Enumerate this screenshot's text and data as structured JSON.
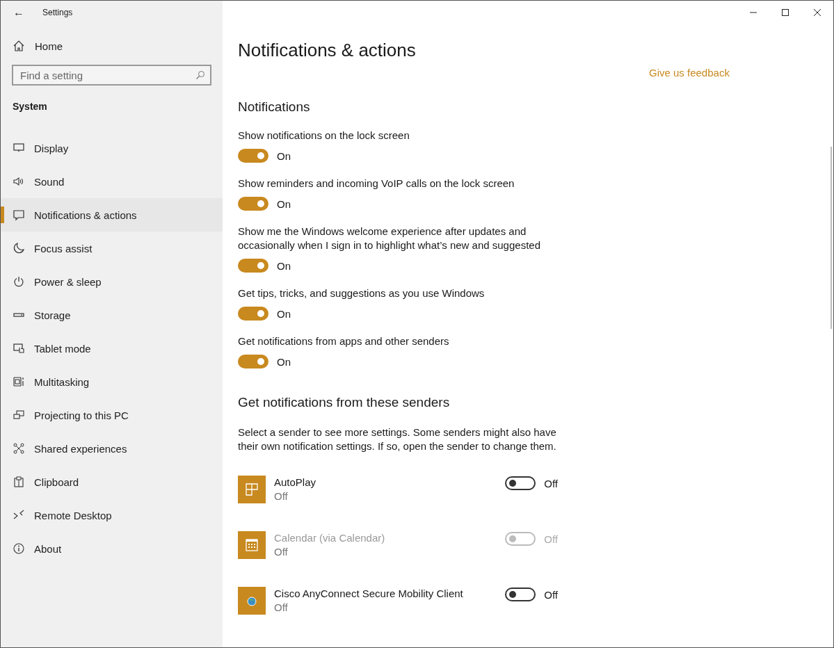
{
  "window": {
    "title": "Settings",
    "back": "←"
  },
  "sidebar": {
    "home": "Home",
    "search": {
      "placeholder": "Find a setting"
    },
    "section": "System",
    "items": [
      {
        "label": "Display",
        "selected": false
      },
      {
        "label": "Sound",
        "selected": false
      },
      {
        "label": "Notifications & actions",
        "selected": true
      },
      {
        "label": "Focus assist",
        "selected": false
      },
      {
        "label": "Power & sleep",
        "selected": false
      },
      {
        "label": "Storage",
        "selected": false
      },
      {
        "label": "Tablet mode",
        "selected": false
      },
      {
        "label": "Multitasking",
        "selected": false
      },
      {
        "label": "Projecting to this PC",
        "selected": false
      },
      {
        "label": "Shared experiences",
        "selected": false
      },
      {
        "label": "Clipboard",
        "selected": false
      },
      {
        "label": "Remote Desktop",
        "selected": false
      },
      {
        "label": "About",
        "selected": false
      }
    ]
  },
  "main": {
    "title": "Notifications & actions",
    "feedback_link": "Give us feedback",
    "notifications_heading": "Notifications",
    "settings": [
      {
        "label": "Show notifications on the lock screen",
        "on": true,
        "state": "On"
      },
      {
        "label": "Show reminders and incoming VoIP calls on the lock screen",
        "on": true,
        "state": "On"
      },
      {
        "label": "Show me the Windows welcome experience after updates and occasionally when I sign in to highlight what’s new and suggested",
        "on": true,
        "state": "On"
      },
      {
        "label": "Get tips, tricks, and suggestions as you use Windows",
        "on": true,
        "state": "On"
      },
      {
        "label": "Get notifications from apps and other senders",
        "on": true,
        "state": "On"
      }
    ],
    "senders_heading": "Get notifications from these senders",
    "senders_description": "Select a sender to see more settings. Some senders might also have their own notification settings. If so, open the sender to change them.",
    "senders": [
      {
        "name": "AutoPlay",
        "status": "Off",
        "on": false,
        "disabled": false,
        "state": "Off"
      },
      {
        "name": "Calendar (via Calendar)",
        "status": "Off",
        "on": false,
        "disabled": true,
        "state": "Off"
      },
      {
        "name": "Cisco AnyConnect Secure Mobility Client",
        "status": "Off",
        "on": false,
        "disabled": false,
        "state": "Off"
      }
    ]
  }
}
